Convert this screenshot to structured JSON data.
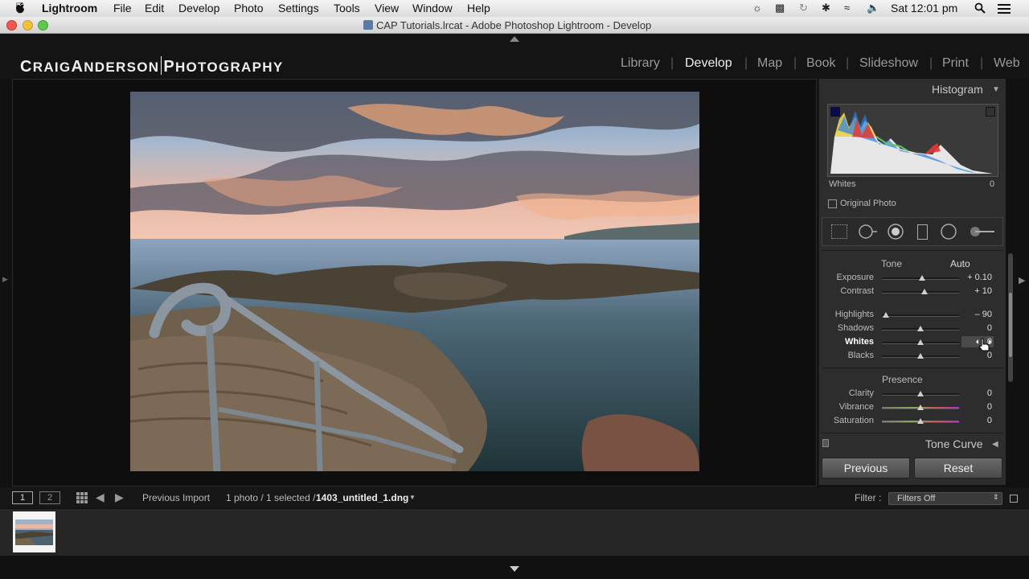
{
  "menubar": {
    "apple": "",
    "app": "Lightroom",
    "items": [
      "File",
      "Edit",
      "Develop",
      "Photo",
      "Settings",
      "Tools",
      "View",
      "Window",
      "Help"
    ],
    "clock": "Sat 12:01 pm"
  },
  "window": {
    "title": "CAP Tutorials.lrcat - Adobe Photoshop Lightroom - Develop"
  },
  "identity_plate": {
    "name_a": "C",
    "name_b": "RAIG",
    "name_c": "A",
    "name_d": "NDERSON",
    "name_e": "P",
    "name_f": "HOTOGRAPHY"
  },
  "modules": [
    "Library",
    "Develop",
    "Map",
    "Book",
    "Slideshow",
    "Print",
    "Web"
  ],
  "active_module": "Develop",
  "histogram": {
    "title": "Histogram",
    "readout_label": "Whites",
    "readout_value": "0",
    "original_photo": "Original Photo"
  },
  "basic": {
    "tone_label": "Tone",
    "auto_label": "Auto",
    "sliders": [
      {
        "label": "Exposure",
        "value": "+ 0.10",
        "pos": 0.52
      },
      {
        "label": "Contrast",
        "value": "+ 10",
        "pos": 0.55
      },
      {
        "label": "Highlights",
        "value": "– 90",
        "pos": 0.05
      },
      {
        "label": "Shadows",
        "value": "0",
        "pos": 0.5
      },
      {
        "label": "Whites",
        "value": "0",
        "pos": 0.5
      },
      {
        "label": "Blacks",
        "value": "0",
        "pos": 0.5
      }
    ],
    "presence_label": "Presence",
    "presence": [
      {
        "label": "Clarity",
        "value": "0",
        "pos": 0.5
      },
      {
        "label": "Vibrance",
        "value": "0",
        "pos": 0.5
      },
      {
        "label": "Saturation",
        "value": "0",
        "pos": 0.5
      }
    ]
  },
  "tone_curve": {
    "title": "Tone Curve"
  },
  "buttons": {
    "previous": "Previous",
    "reset": "Reset"
  },
  "filmstrip": {
    "view1": "1",
    "view2": "2",
    "source": "Previous Import",
    "count": "1 photo / 1 selected /",
    "filename": "1403_untitled_1.dng",
    "filter_label": "Filter :",
    "filter_value": "Filters Off"
  },
  "colors": {
    "accent": "#eeeeee",
    "panel": "#2d2d2d",
    "background": "#111111"
  }
}
